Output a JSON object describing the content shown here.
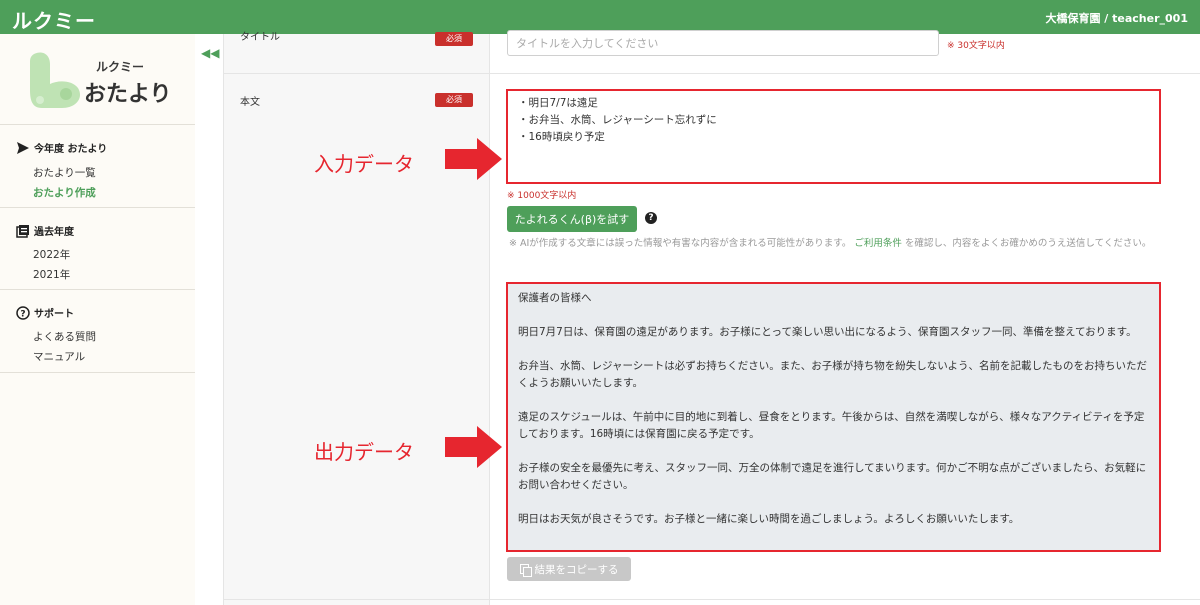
{
  "header": {
    "brand": "ルクミー",
    "user": "大橋保育園 / teacher_001"
  },
  "sidebar": {
    "collapse_icon": "double-chevron-left-icon",
    "logo_small": "ルクミー",
    "logo_big": "おたより",
    "sections": [
      {
        "heading": "今年度 おたより",
        "icon": "send-icon",
        "items": [
          {
            "label": "おたより一覧",
            "active": false
          },
          {
            "label": "おたより作成",
            "active": true
          }
        ]
      },
      {
        "heading": "過去年度",
        "icon": "archive-icon",
        "items": [
          {
            "label": "2022年",
            "active": false
          },
          {
            "label": "2021年",
            "active": false
          }
        ]
      },
      {
        "heading": "サポート",
        "icon": "help-circle-icon",
        "items": [
          {
            "label": "よくある質問",
            "active": false
          },
          {
            "label": "マニュアル",
            "active": false
          }
        ]
      }
    ]
  },
  "form": {
    "title": {
      "label": "タイトル",
      "required_badge": "必須",
      "placeholder": "タイトルを入力してください",
      "limit": "※ 30文字以内"
    },
    "body": {
      "label": "本文",
      "required_badge": "必須",
      "lines": [
        "・明日7/7は遠足",
        "・お弁当、水筒、レジャーシート忘れずに",
        "・16時頃戻り予定"
      ],
      "limit": "※ 1000文字以内"
    },
    "ai_button": "たよれるくん(β)を試す",
    "disclaimer_pre": "※ AIが作成する文章には誤った情報や有害な内容が含まれる可能性があります。",
    "disclaimer_link": "ご利用条件",
    "disclaimer_post": "を確認し、内容をよくお確かめのうえ送信してください。",
    "output_paragraphs": [
      "保護者の皆様へ",
      "明日7月7日は、保育園の遠足があります。お子様にとって楽しい思い出になるよう、保育園スタッフ一同、準備を整えております。",
      "お弁当、水筒、レジャーシートは必ずお持ちください。また、お子様が持ち物を紛失しないよう、名前を記載したものをお持ちいただくようお願いいたします。",
      "遠足のスケジュールは、午前中に目的地に到着し、昼食をとります。午後からは、自然を満喫しながら、様々なアクティビティを予定しております。16時頃には保育園に戻る予定です。",
      "お子様の安全を最優先に考え、スタッフ一同、万全の体制で遠足を進行してまいります。何かご不明な点がございましたら、お気軽にお問い合わせください。",
      "明日はお天気が良さそうです。お子様と一緒に楽しい時間を過ごしましょう。よろしくお願いいたします。"
    ],
    "copy_button": "結果をコピーする"
  },
  "annotations": {
    "input_label": "入力データ",
    "output_label": "出力データ",
    "color": "#e6262f"
  },
  "colors": {
    "brand_green": "#4e9f5a",
    "required_red": "#c9302c"
  }
}
